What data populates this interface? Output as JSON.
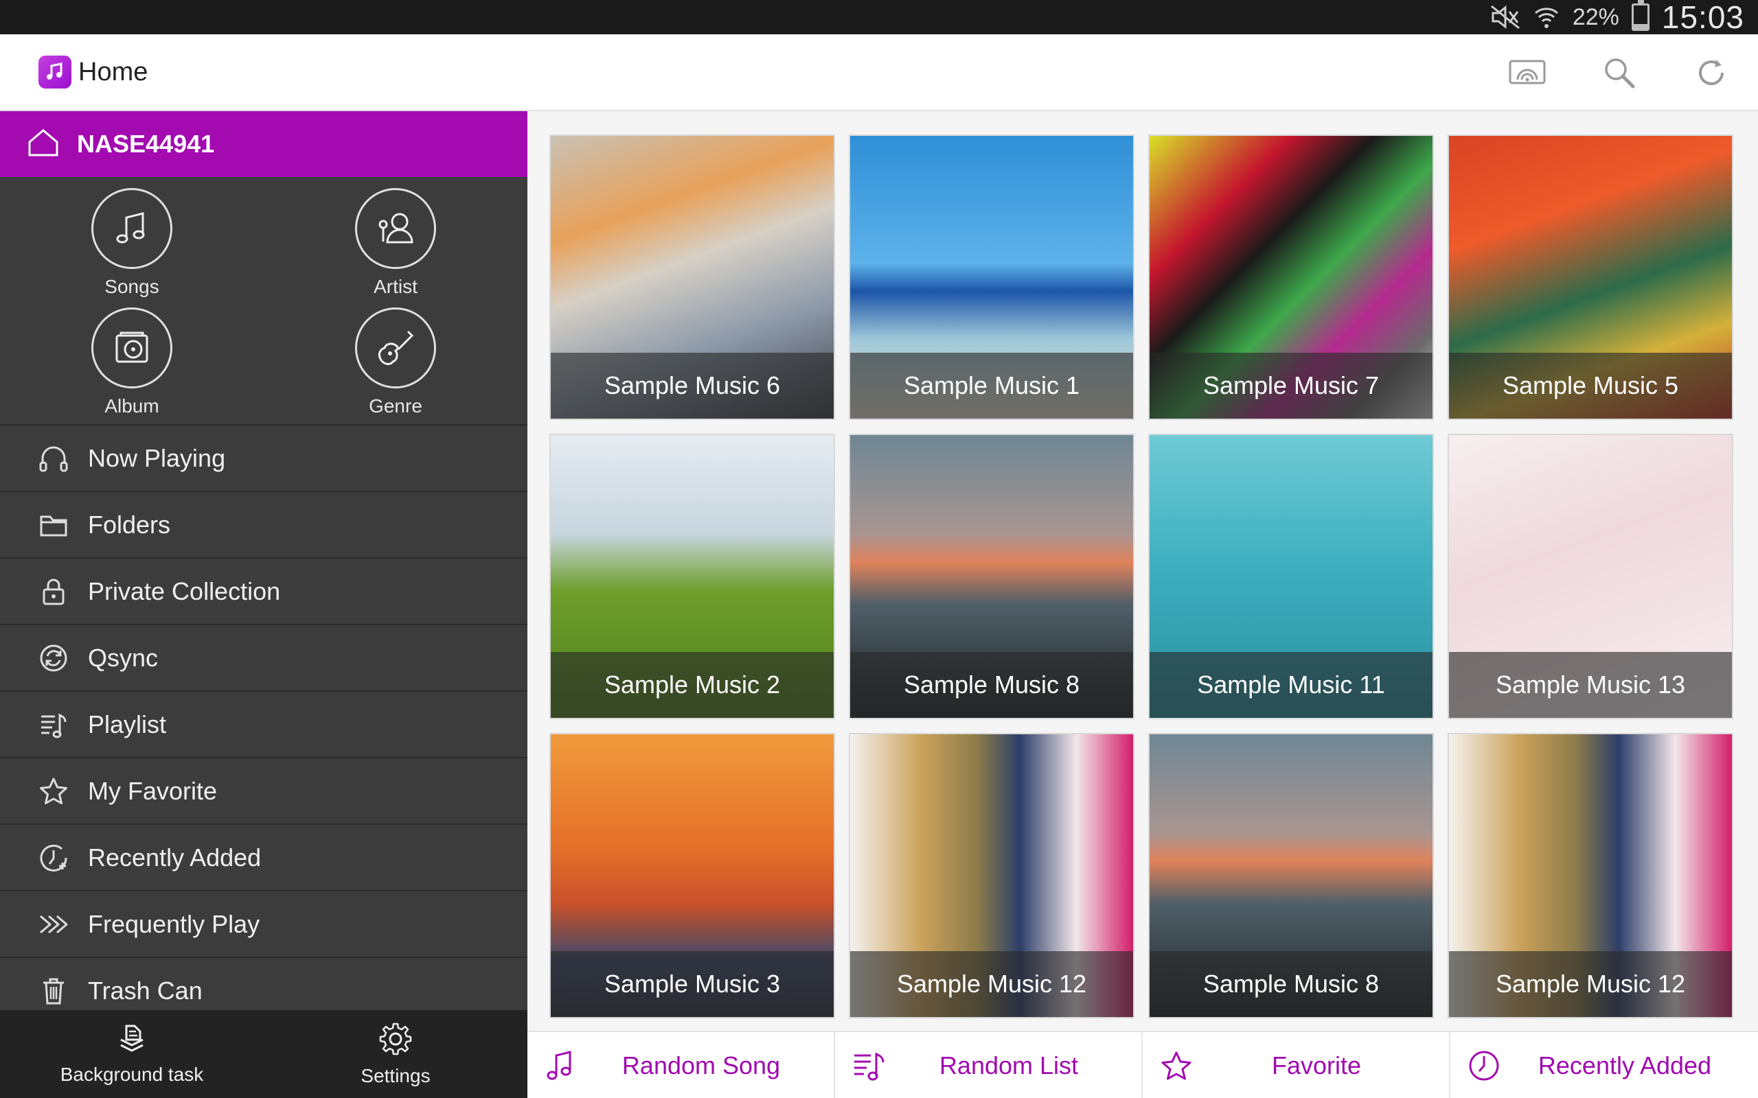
{
  "status_bar": {
    "battery": "22%",
    "time": "15:03",
    "battery_level": 0.22,
    "icons": [
      "mute-icon",
      "wifi-icon",
      "battery-icon"
    ]
  },
  "action_bar": {
    "title": "Home",
    "actions": [
      "cast-icon",
      "search-icon",
      "refresh-icon"
    ]
  },
  "sidebar": {
    "nas_name": "NASE44941",
    "categories": [
      {
        "label": "Songs",
        "icon": "music-note-icon"
      },
      {
        "label": "Artist",
        "icon": "artist-icon"
      },
      {
        "label": "Album",
        "icon": "album-icon"
      },
      {
        "label": "Genre",
        "icon": "guitar-icon"
      }
    ],
    "menu": [
      {
        "label": "Now Playing",
        "icon": "headphones-icon"
      },
      {
        "label": "Folders",
        "icon": "folder-icon"
      },
      {
        "label": "Private Collection",
        "icon": "lock-icon"
      },
      {
        "label": "Qsync",
        "icon": "sync-icon"
      },
      {
        "label": "Playlist",
        "icon": "playlist-icon"
      },
      {
        "label": "My Favorite",
        "icon": "star-icon"
      },
      {
        "label": "Recently Added",
        "icon": "clock-icon"
      },
      {
        "label": "Frequently Play",
        "icon": "fast-forward-icon"
      },
      {
        "label": "Trash Can",
        "icon": "trash-icon"
      }
    ],
    "bottom": [
      {
        "label": "Background task",
        "icon": "stack-icon"
      },
      {
        "label": "Settings",
        "icon": "gear-icon"
      }
    ]
  },
  "grid": {
    "tiles": [
      {
        "title": "Sample Music 6"
      },
      {
        "title": "Sample Music 1"
      },
      {
        "title": "Sample Music 7"
      },
      {
        "title": "Sample Music 5"
      },
      {
        "title": "Sample Music 2"
      },
      {
        "title": "Sample Music 8"
      },
      {
        "title": "Sample Music 11"
      },
      {
        "title": "Sample Music 13"
      },
      {
        "title": "Sample Music 3"
      },
      {
        "title": "Sample Music 12"
      },
      {
        "title": "Sample Music 8"
      },
      {
        "title": "Sample Music 12"
      }
    ]
  },
  "bottom_bar": {
    "buttons": [
      {
        "label": "Random Song",
        "icon": "music-note-icon"
      },
      {
        "label": "Random List",
        "icon": "playlist-icon"
      },
      {
        "label": "Favorite",
        "icon": "star-icon"
      },
      {
        "label": "Recently Added",
        "icon": "clock-icon"
      }
    ]
  },
  "colors": {
    "accent": "#a30ab0",
    "sidebar_bg": "#3c3c3c",
    "statusbar_bg": "#1a1a1a"
  }
}
